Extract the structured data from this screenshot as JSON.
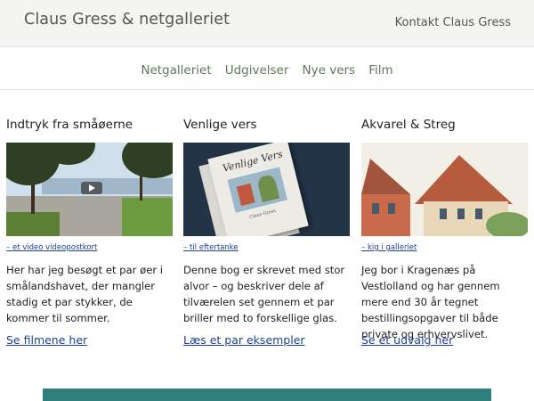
{
  "header": {
    "site_title": "Claus Gress & netgalleriet",
    "contact_link": "Kontakt Claus Gress"
  },
  "nav": {
    "items": [
      "Netgalleriet",
      "Udgivelser",
      "Nye vers",
      "Film"
    ]
  },
  "columns": [
    {
      "title": "Indtryk fra småøerne",
      "image_icon": "video-play-icon",
      "caption": "– et video videopostkort",
      "description": "Her har jeg besøgt et par øer i smålandshavet, der mangler stadig et par stykker, de kommer til sommer.",
      "link": "Se filmene her"
    },
    {
      "title": "Venlige vers",
      "book_title": "Venlige Vers",
      "book_author": "Claus Gress",
      "caption": "– til eftertanke",
      "description": "Denne bog er skrevet med stor alvor – og beskriver dele af tilværelen set gennem et par briller med to forskellige glas.",
      "link": "Læs et par eksempler"
    },
    {
      "title": "Akvarel & Streg",
      "caption": "– kig i galleriet",
      "description": "Jeg bor i Kragenæs på Vestlolland og har gennem mere end 30 år tegnet bestillingsopgaver til både private og erhvervslivet.",
      "link": "Se et udvalg her"
    }
  ],
  "colors": {
    "nav_link": "#5c7a56",
    "link": "#1f3f8f",
    "footer_bar": "#2e7f7c",
    "topbar_bg": "#f4f4f2"
  }
}
